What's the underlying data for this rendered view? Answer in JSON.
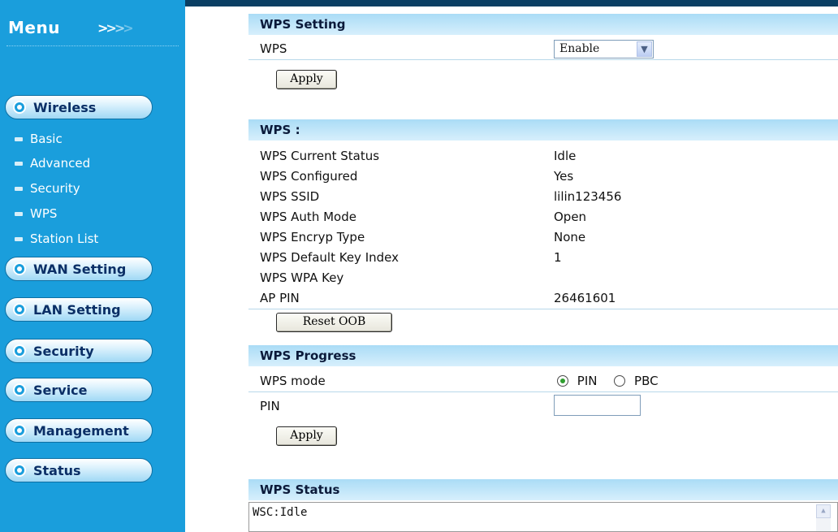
{
  "sidebar": {
    "menu_title": "Menu",
    "menu_arrows": [
      ">",
      ">",
      ">",
      ">"
    ],
    "groups": {
      "wireless": "Wireless",
      "wan": "WAN Setting",
      "lan": "LAN Setting",
      "security": "Security",
      "service": "Service",
      "management": "Management",
      "status": "Status"
    },
    "wireless_items": {
      "basic": "Basic",
      "advanced": "Advanced",
      "security": "Security",
      "wps": "WPS",
      "station_list": "Station List"
    }
  },
  "wps_setting": {
    "header": "WPS Setting",
    "wps_label": "WPS",
    "wps_value": "Enable",
    "apply_label": "Apply"
  },
  "wps_info": {
    "header": "WPS :",
    "rows": [
      {
        "label": "WPS Current Status",
        "value": "Idle"
      },
      {
        "label": "WPS Configured",
        "value": "Yes"
      },
      {
        "label": "WPS SSID",
        "value": "lilin123456"
      },
      {
        "label": "WPS Auth Mode",
        "value": "Open"
      },
      {
        "label": "WPS Encryp Type",
        "value": "None"
      },
      {
        "label": "WPS Default Key Index",
        "value": "1"
      },
      {
        "label": "WPS WPA Key",
        "value": ""
      },
      {
        "label": "AP PIN",
        "value": "26461601"
      }
    ],
    "reset_label": "Reset OOB"
  },
  "wps_progress": {
    "header": "WPS Progress",
    "mode_label": "WPS mode",
    "option_pin": "PIN",
    "option_pbc": "PBC",
    "selected": "PIN",
    "pin_label": "PIN",
    "pin_value": "",
    "apply_label": "Apply"
  },
  "wps_status": {
    "header": "WPS Status",
    "text": "WSC:Idle"
  },
  "colors": {
    "sidebar": "#1a9edc",
    "header_gradient_start": "#aadcf6",
    "topbar": "#0a3f63"
  }
}
